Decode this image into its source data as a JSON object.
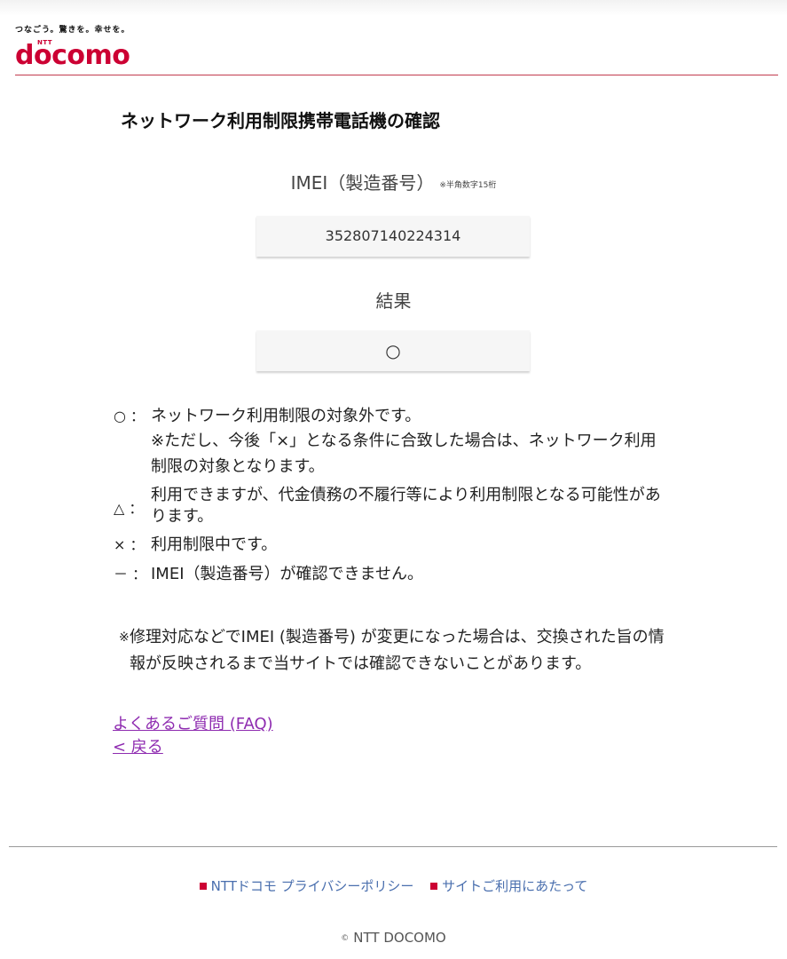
{
  "header": {
    "tagline": "つなごう。驚きを。幸せを。",
    "logo_brand_small": "NTT",
    "logo_brand": "docomo"
  },
  "page": {
    "title": "ネットワーク利用制限携帯電話機の確認"
  },
  "imei": {
    "label": "IMEI（製造番号）",
    "note": "※半角数字15桁",
    "value": "352807140224314"
  },
  "result": {
    "label": "結果",
    "value": "○"
  },
  "legend": [
    {
      "symbol": "○ ：",
      "text": "ネットワーク利用制限の対象外です。",
      "sub": "※ただし、今後「×」となる条件に合致した場合は、ネットワーク利用制限の対象となります。"
    },
    {
      "symbol": "△ ：",
      "text": "利用できますが、代金債務の不履行等により利用制限となる可能性があります。"
    },
    {
      "symbol": "× ：",
      "text": "利用制限中です。"
    },
    {
      "symbol": "－ ：",
      "text": "IMEI（製造番号）が確認できません。"
    }
  ],
  "remark": {
    "mark": "※",
    "text": "修理対応などでIMEI (製造番号) が変更になった場合は、交換された旨の情報が反映されるまで当サイトでは確認できないことがあります。"
  },
  "links": {
    "faq": "よくあるご質問 (FAQ)",
    "back": "< 戻る"
  },
  "footer": {
    "privacy": "NTTドコモ プライバシーポリシー",
    "terms": "サイトご利用にあたって",
    "copyright_symbol": "©",
    "copyright": "NTT DOCOMO"
  },
  "colors": {
    "brand": "#cc0033",
    "link": "#8e2bb0",
    "footer_link": "#4a6fae"
  }
}
